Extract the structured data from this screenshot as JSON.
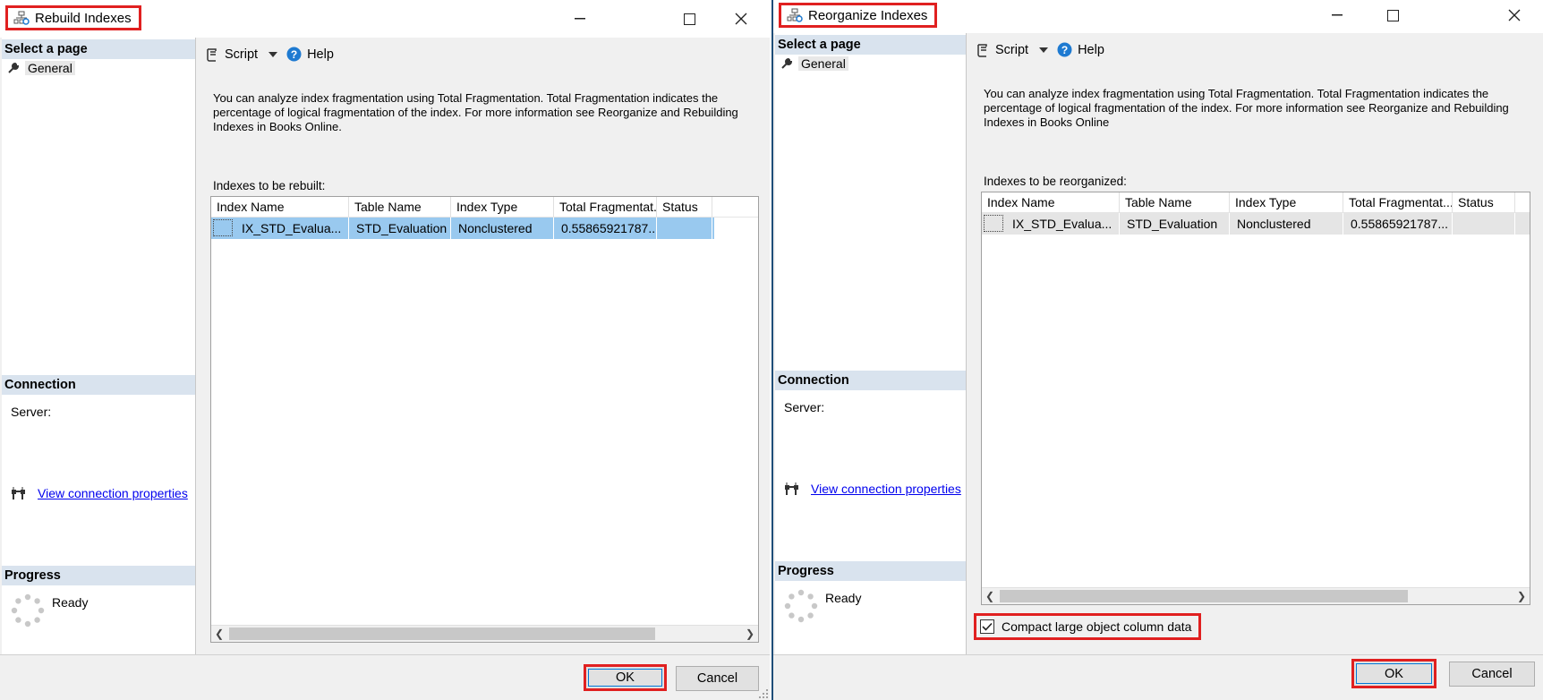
{
  "rebuild": {
    "title": "Rebuild Indexes",
    "sidebar": {
      "select_page": "Select a page",
      "general": "General",
      "connection": "Connection",
      "server_label": "Server:",
      "view_connection": "View connection properties",
      "progress": "Progress",
      "status": "Ready"
    },
    "toolbar": {
      "script": "Script",
      "help": "Help"
    },
    "description": "You can analyze index fragmentation using Total Fragmentation. Total Fragmentation indicates the percentage of logical fragmentation of the index. For more information see Reorganize and Rebuilding Indexes in Books Online.",
    "grid_label": "Indexes to be rebuilt:",
    "columns": [
      "Index Name",
      "Table Name",
      "Index Type",
      "Total Fragmentat...",
      "Status"
    ],
    "rows": [
      {
        "index_name": "IX_STD_Evalua...",
        "table_name": "STD_Evaluation",
        "index_type": "Nonclustered",
        "fragmentation": "0.55865921787...",
        "status": ""
      }
    ],
    "ok": "OK",
    "cancel": "Cancel"
  },
  "reorganize": {
    "title": "Reorganize Indexes",
    "sidebar": {
      "select_page": "Select a page",
      "general": "General",
      "connection": "Connection",
      "server_label": "Server:",
      "view_connection": "View connection properties",
      "progress": "Progress",
      "status": "Ready"
    },
    "toolbar": {
      "script": "Script",
      "help": "Help"
    },
    "description": "You can analyze index fragmentation using Total Fragmentation. Total Fragmentation indicates the percentage of logical fragmentation of the index. For more information see Reorganize and Rebuilding Indexes in Books Online",
    "grid_label": "Indexes to be reorganized:",
    "columns": [
      "Index Name",
      "Table Name",
      "Index Type",
      "Total Fragmentat...",
      "Status"
    ],
    "rows": [
      {
        "index_name": "IX_STD_Evalua...",
        "table_name": "STD_Evaluation",
        "index_type": "Nonclustered",
        "fragmentation": "0.55865921787...",
        "status": ""
      }
    ],
    "compact_label": "Compact large object column data",
    "compact_checked": true,
    "ok": "OK",
    "cancel": "Cancel"
  },
  "colors": {
    "highlight_box": "#e02020",
    "selected_row": "#99c9ef",
    "unselected_row": "#e5e5e5",
    "section_header": "#d9e3ee",
    "link": "#0000ee",
    "help_icon": "#1e7ad1"
  }
}
